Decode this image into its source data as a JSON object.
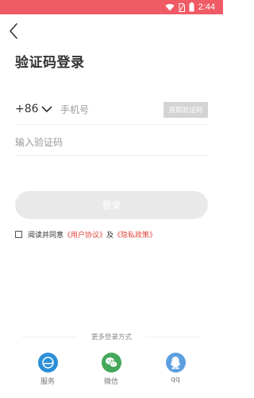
{
  "status_bar": {
    "time": "2:44",
    "color": "#f05a64"
  },
  "header": {
    "title": "验证码登录"
  },
  "phone": {
    "country_code": "+86",
    "placeholder": "手机号",
    "get_code_label": "获取验证码"
  },
  "code": {
    "placeholder": "输入验证码"
  },
  "login": {
    "label": "登录"
  },
  "agreement": {
    "prefix": "阅读并同意",
    "user_agreement": "《用户协议》",
    "and": "及",
    "privacy_policy": "《隐私政策》"
  },
  "more_login": {
    "title": "更多登录方式",
    "options": [
      {
        "label": "服务",
        "icon": "service-icon",
        "color": "#2b8fd8"
      },
      {
        "label": "微信",
        "icon": "wechat-icon",
        "color": "#45a85a"
      },
      {
        "label": "qq",
        "icon": "qq-icon",
        "color": "#5c9fe0"
      }
    ]
  }
}
